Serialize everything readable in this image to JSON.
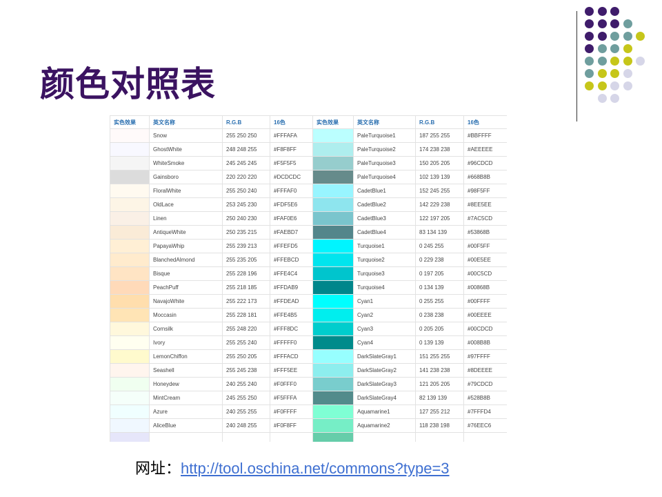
{
  "title": "颜色对照表",
  "columns": [
    "实色效果",
    "英文名称",
    "R.G.B",
    "16色",
    "实色效果",
    "英文名称",
    "R.G.B",
    "16色"
  ],
  "rows": [
    {
      "l_name": "Snow",
      "l_rgb": "255 250 250",
      "l_hex": "#FFFAFA",
      "l_color": "#FFFAFA",
      "r_name": "PaleTurquoise1",
      "r_rgb": "187 255 255",
      "r_hex": "#BBFFFF",
      "r_color": "#BBFFFF"
    },
    {
      "l_name": "GhostWhite",
      "l_rgb": "248 248 255",
      "l_hex": "#F8F8FF",
      "l_color": "#F8F8FF",
      "r_name": "PaleTurquoise2",
      "r_rgb": "174 238 238",
      "r_hex": "#AEEEEE",
      "r_color": "#AEEEEE"
    },
    {
      "l_name": "WhiteSmoke",
      "l_rgb": "245 245 245",
      "l_hex": "#F5F5F5",
      "l_color": "#F5F5F5",
      "r_name": "PaleTurquoise3",
      "r_rgb": "150 205 205",
      "r_hex": "#96CDCD",
      "r_color": "#96CDCD"
    },
    {
      "l_name": "Gainsboro",
      "l_rgb": "220 220 220",
      "l_hex": "#DCDCDC",
      "l_color": "#DCDCDC",
      "r_name": "PaleTurquoise4",
      "r_rgb": "102 139 139",
      "r_hex": "#668B8B",
      "r_color": "#668B8B"
    },
    {
      "l_name": "FloralWhite",
      "l_rgb": "255 250 240",
      "l_hex": "#FFFAF0",
      "l_color": "#FFFAF0",
      "r_name": "CadetBlue1",
      "r_rgb": "152 245 255",
      "r_hex": "#98F5FF",
      "r_color": "#98F5FF"
    },
    {
      "l_name": "OldLace",
      "l_rgb": "253 245 230",
      "l_hex": "#FDF5E6",
      "l_color": "#FDF5E6",
      "r_name": "CadetBlue2",
      "r_rgb": "142 229 238",
      "r_hex": "#8EE5EE",
      "r_color": "#8EE5EE"
    },
    {
      "l_name": "Linen",
      "l_rgb": "250 240 230",
      "l_hex": "#FAF0E6",
      "l_color": "#FAF0E6",
      "r_name": "CadetBlue3",
      "r_rgb": "122 197 205",
      "r_hex": "#7AC5CD",
      "r_color": "#7AC5CD"
    },
    {
      "l_name": "AntiqueWhite",
      "l_rgb": "250 235 215",
      "l_hex": "#FAEBD7",
      "l_color": "#FAEBD7",
      "r_name": "CadetBlue4",
      "r_rgb": "83 134 139",
      "r_hex": "#53868B",
      "r_color": "#53868B"
    },
    {
      "l_name": "PapayaWhip",
      "l_rgb": "255 239 213",
      "l_hex": "#FFEFD5",
      "l_color": "#FFEFD5",
      "r_name": "Turquoise1",
      "r_rgb": "0 245 255",
      "r_hex": "#00F5FF",
      "r_color": "#00F5FF"
    },
    {
      "l_name": "BlanchedAlmond",
      "l_rgb": "255 235 205",
      "l_hex": "#FFEBCD",
      "l_color": "#FFEBCD",
      "r_name": "Turquoise2",
      "r_rgb": "0 229 238",
      "r_hex": "#00E5EE",
      "r_color": "#00E5EE"
    },
    {
      "l_name": "Bisque",
      "l_rgb": "255 228 196",
      "l_hex": "#FFE4C4",
      "l_color": "#FFE4C4",
      "r_name": "Turquoise3",
      "r_rgb": "0 197 205",
      "r_hex": "#00C5CD",
      "r_color": "#00C5CD"
    },
    {
      "l_name": "PeachPuff",
      "l_rgb": "255 218 185",
      "l_hex": "#FFDAB9",
      "l_color": "#FFDAB9",
      "r_name": "Turquoise4",
      "r_rgb": "0 134 139",
      "r_hex": "#00868B",
      "r_color": "#00868B"
    },
    {
      "l_name": "NavajoWhite",
      "l_rgb": "255 222 173",
      "l_hex": "#FFDEAD",
      "l_color": "#FFDEAD",
      "r_name": "Cyan1",
      "r_rgb": "0 255 255",
      "r_hex": "#00FFFF",
      "r_color": "#00FFFF"
    },
    {
      "l_name": "Moccasin",
      "l_rgb": "255 228 181",
      "l_hex": "#FFE4B5",
      "l_color": "#FFE4B5",
      "r_name": "Cyan2",
      "r_rgb": "0 238 238",
      "r_hex": "#00EEEE",
      "r_color": "#00EEEE"
    },
    {
      "l_name": "Cornsilk",
      "l_rgb": "255 248 220",
      "l_hex": "#FFF8DC",
      "l_color": "#FFF8DC",
      "r_name": "Cyan3",
      "r_rgb": "0 205 205",
      "r_hex": "#00CDCD",
      "r_color": "#00CDCD"
    },
    {
      "l_name": "Ivory",
      "l_rgb": "255 255 240",
      "l_hex": "#FFFFF0",
      "l_color": "#FFFFF0",
      "r_name": "Cyan4",
      "r_rgb": "0 139 139",
      "r_hex": "#008B8B",
      "r_color": "#008B8B"
    },
    {
      "l_name": "LemonChiffon",
      "l_rgb": "255 250 205",
      "l_hex": "#FFFACD",
      "l_color": "#FFFACD",
      "r_name": "DarkSlateGray1",
      "r_rgb": "151 255 255",
      "r_hex": "#97FFFF",
      "r_color": "#97FFFF"
    },
    {
      "l_name": "Seashell",
      "l_rgb": "255 245 238",
      "l_hex": "#FFF5EE",
      "l_color": "#FFF5EE",
      "r_name": "DarkSlateGray2",
      "r_rgb": "141 238 238",
      "r_hex": "#8DEEEE",
      "r_color": "#8DEEEE"
    },
    {
      "l_name": "Honeydew",
      "l_rgb": "240 255 240",
      "l_hex": "#F0FFF0",
      "l_color": "#F0FFF0",
      "r_name": "DarkSlateGray3",
      "r_rgb": "121 205 205",
      "r_hex": "#79CDCD",
      "r_color": "#79CDCD"
    },
    {
      "l_name": "MintCream",
      "l_rgb": "245 255 250",
      "l_hex": "#F5FFFA",
      "l_color": "#F5FFFA",
      "r_name": "DarkSlateGray4",
      "r_rgb": "82 139 139",
      "r_hex": "#528B8B",
      "r_color": "#528B8B"
    },
    {
      "l_name": "Azure",
      "l_rgb": "240 255 255",
      "l_hex": "#F0FFFF",
      "l_color": "#F0FFFF",
      "r_name": "Aquamarine1",
      "r_rgb": "127 255 212",
      "r_hex": "#7FFFD4",
      "r_color": "#7FFFD4"
    },
    {
      "l_name": "AliceBlue",
      "l_rgb": "240 248 255",
      "l_hex": "#F0F8FF",
      "l_color": "#F0F8FF",
      "r_name": "Aquamarine2",
      "r_rgb": "118 238 198",
      "r_hex": "#76EEC6",
      "r_color": "#76EEC6"
    },
    {
      "l_name": "",
      "l_rgb": "",
      "l_hex": "",
      "l_color": "#E6E6FA",
      "r_name": "",
      "r_rgb": "",
      "r_hex": "",
      "r_color": "#66CDAA"
    }
  ],
  "url_label": "网址：",
  "url": "http://tool.oschina.net/commons?type=3",
  "decor_dots": [
    [
      "#3f1c6b",
      "#3f1c6b",
      "#3f1c6b",
      null,
      null
    ],
    [
      "#3f1c6b",
      "#3f1c6b",
      "#3f1c6b",
      "#6f9e9e",
      null
    ],
    [
      "#3f1c6b",
      "#3f1c6b",
      "#6f9e9e",
      "#6f9e9e",
      "#c6c61a"
    ],
    [
      "#3f1c6b",
      "#6f9e9e",
      "#6f9e9e",
      "#c6c61a",
      null
    ],
    [
      "#6f9e9e",
      "#6f9e9e",
      "#c6c61a",
      "#c6c61a",
      "#d6d6e8"
    ],
    [
      "#6f9e9e",
      "#c6c61a",
      "#c6c61a",
      "#d6d6e8",
      null
    ],
    [
      "#c6c61a",
      "#c6c61a",
      "#d6d6e8",
      "#d6d6e8",
      null
    ],
    [
      null,
      "#d6d6e8",
      "#d6d6e8",
      null,
      null
    ]
  ]
}
